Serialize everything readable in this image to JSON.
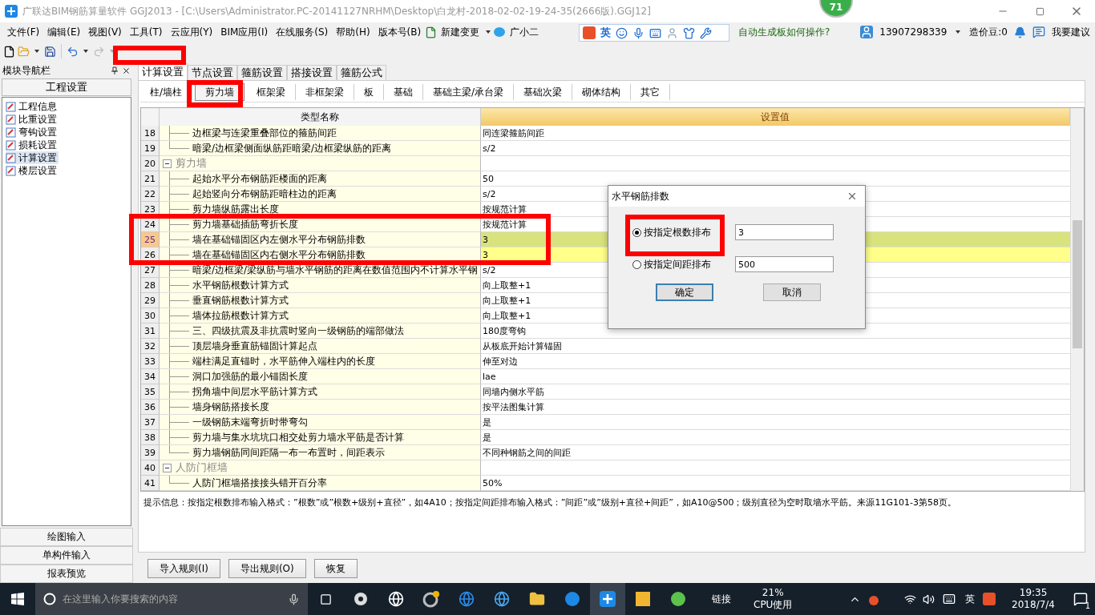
{
  "window": {
    "title": "广联达BIM钢筋算量软件 GGJ2013 - [C:\\Users\\Administrator.PC-20141127NRHM\\Desktop\\白龙村-2018-02-02-19-24-35(2666版).GGJ12]",
    "badge": "71"
  },
  "ime_bar": {
    "mode": "英"
  },
  "menu": [
    "文件(F)",
    "编辑(E)",
    "视图(V)",
    "工具(T)",
    "云应用(Y)",
    "BIM应用(I)",
    "在线服务(S)",
    "帮助(H)",
    "版本号(B)"
  ],
  "menu_extras": {
    "change": "新建变更",
    "assistant": "广小二"
  },
  "help_link": "自动生成板如何操作?",
  "account": {
    "phone": "13907298339",
    "beans": "造价豆:0",
    "suggest": "我要建议"
  },
  "toolbar": {
    "redo_disabled": true
  },
  "nav": {
    "title": "模块导航栏",
    "section": "工程设置",
    "items": [
      {
        "label": "工程信息",
        "selected": false
      },
      {
        "label": "比重设置",
        "selected": false
      },
      {
        "label": "弯钩设置",
        "selected": false
      },
      {
        "label": "损耗设置",
        "selected": false
      },
      {
        "label": "计算设置",
        "selected": true
      },
      {
        "label": "楼层设置",
        "selected": false
      }
    ],
    "footer": [
      "绘图输入",
      "单构件输入",
      "报表预览"
    ]
  },
  "tabs": [
    {
      "label": "计算设置",
      "selected": true
    },
    {
      "label": "节点设置",
      "selected": false
    },
    {
      "label": "箍筋设置",
      "selected": false
    },
    {
      "label": "搭接设置",
      "selected": false
    },
    {
      "label": "箍筋公式",
      "selected": false
    }
  ],
  "subtabs": [
    {
      "label": "柱/墙柱",
      "selected": false
    },
    {
      "label": "剪力墙",
      "selected": true
    },
    {
      "label": "框架梁",
      "selected": false
    },
    {
      "label": "非框架梁",
      "selected": false
    },
    {
      "label": "板",
      "selected": false
    },
    {
      "label": "基础",
      "selected": false
    },
    {
      "label": "基础主梁/承台梁",
      "selected": false
    },
    {
      "label": "基础次梁",
      "selected": false
    },
    {
      "label": "砌体结构",
      "selected": false
    },
    {
      "label": "其它",
      "selected": false
    }
  ],
  "table": {
    "columns": [
      "类型名称",
      "设置值"
    ],
    "rows": [
      {
        "num": "18",
        "kind": "item",
        "name": "边框梁与连梁重叠部位的箍筋间距",
        "value": "同连梁箍筋间距",
        "selected": false,
        "current": false
      },
      {
        "num": "19",
        "kind": "item",
        "name": "暗梁/边框梁侧面纵筋距暗梁/边框梁纵筋的距离",
        "value": "s/2",
        "selected": false,
        "current": false
      },
      {
        "num": "20",
        "kind": "group",
        "name": "剪力墙",
        "expanded": true,
        "selected": false,
        "current": false
      },
      {
        "num": "21",
        "kind": "item",
        "name": "起始水平分布钢筋距楼面的距离",
        "value": "50",
        "selected": false,
        "current": false
      },
      {
        "num": "22",
        "kind": "item",
        "name": "起始竖向分布钢筋距暗柱边的距离",
        "value": "s/2",
        "selected": false,
        "current": false
      },
      {
        "num": "23",
        "kind": "item",
        "name": "剪力墙纵筋露出长度",
        "value": "按规范计算",
        "selected": false,
        "current": false
      },
      {
        "num": "24",
        "kind": "item",
        "name": "剪力墙基础插筋弯折长度",
        "value": "按规范计算",
        "selected": false,
        "current": false
      },
      {
        "num": "25",
        "kind": "item",
        "name": "墙在基础锚固区内左侧水平分布钢筋排数",
        "value": "3",
        "selected": true,
        "current": true
      },
      {
        "num": "26",
        "kind": "item",
        "name": "墙在基础锚固区内右侧水平分布钢筋排数",
        "value": "3",
        "selected": true,
        "current": false
      },
      {
        "num": "27",
        "kind": "item",
        "name": "暗梁/边框梁/梁纵筋与墙水平钢筋的距离在数值范围内不计算水平钢",
        "value": "s/2",
        "selected": false,
        "current": false
      },
      {
        "num": "28",
        "kind": "item",
        "name": "水平钢筋根数计算方式",
        "value": "向上取整+1",
        "selected": false,
        "current": false
      },
      {
        "num": "29",
        "kind": "item",
        "name": "垂直钢筋根数计算方式",
        "value": "向上取整+1",
        "selected": false,
        "current": false
      },
      {
        "num": "30",
        "kind": "item",
        "name": "墙体拉筋根数计算方式",
        "value": "向上取整+1",
        "selected": false,
        "current": false
      },
      {
        "num": "31",
        "kind": "item",
        "name": "三、四级抗震及非抗震时竖向一级钢筋的端部做法",
        "value": "180度弯钩",
        "selected": false,
        "current": false
      },
      {
        "num": "32",
        "kind": "item",
        "name": "顶层墙身垂直筋锚固计算起点",
        "value": "从板底开始计算锚固",
        "selected": false,
        "current": false
      },
      {
        "num": "33",
        "kind": "item",
        "name": "端柱满足直锚时，水平筋伸入端柱内的长度",
        "value": "伸至对边",
        "selected": false,
        "current": false
      },
      {
        "num": "34",
        "kind": "item",
        "name": "洞口加强筋的最小锚固长度",
        "value": "lae",
        "selected": false,
        "current": false
      },
      {
        "num": "35",
        "kind": "item",
        "name": "拐角墙中间层水平筋计算方式",
        "value": "同墙内侧水平筋",
        "selected": false,
        "current": false
      },
      {
        "num": "36",
        "kind": "item",
        "name": "墙身钢筋搭接长度",
        "value": "按平法图集计算",
        "selected": false,
        "current": false
      },
      {
        "num": "37",
        "kind": "item",
        "name": "一级钢筋末端弯折时带弯勾",
        "value": "是",
        "selected": false,
        "current": false
      },
      {
        "num": "38",
        "kind": "item",
        "name": "剪力墙与集水坑坑口相交处剪力墙水平筋是否计算",
        "value": "是",
        "selected": false,
        "current": false
      },
      {
        "num": "39",
        "kind": "item",
        "name": "剪力墙钢筋同间距隔一布一布置时，间距表示",
        "value": "不同种钢筋之间的间距",
        "selected": false,
        "current": false
      },
      {
        "num": "40",
        "kind": "group",
        "name": "人防门框墙",
        "expanded": true,
        "selected": false,
        "current": false
      },
      {
        "num": "41",
        "kind": "item",
        "name": "人防门框墙搭接接头错开百分率",
        "value": "50%",
        "selected": false,
        "current": false
      }
    ]
  },
  "hint": "提示信息：按指定根数排布输入格式：”根数”或”根数+级别+直径”，如4A10；按指定间距排布输入格式：”间距”或”级别+直径+间距”，如A10@500；级别直径为空时取墙水平筋。来源11G101-3第58页。",
  "buttons": [
    "导入规则(I)",
    "导出规则(O)",
    "恢复"
  ],
  "dialog": {
    "title": "水平钢筋排数",
    "options": [
      {
        "label": "按指定根数排布",
        "selected": true,
        "value": "3"
      },
      {
        "label": "按指定间距排布",
        "selected": false,
        "value": "500"
      }
    ],
    "buttons": [
      {
        "label": "确定",
        "default": true
      },
      {
        "label": "取消",
        "default": false
      }
    ]
  },
  "annotations": [
    {
      "kind": "box"
    },
    {
      "kind": "box"
    },
    {
      "kind": "box"
    },
    {
      "kind": "box"
    }
  ],
  "taskbar": {
    "search": "在这里输入你要搜索的内容",
    "link": "链接",
    "cpu_percent": "21%",
    "cpu_label": "CPU使用",
    "ime": "英",
    "time": "19:35",
    "date": "2018/7/4",
    "notifications": "1"
  }
}
